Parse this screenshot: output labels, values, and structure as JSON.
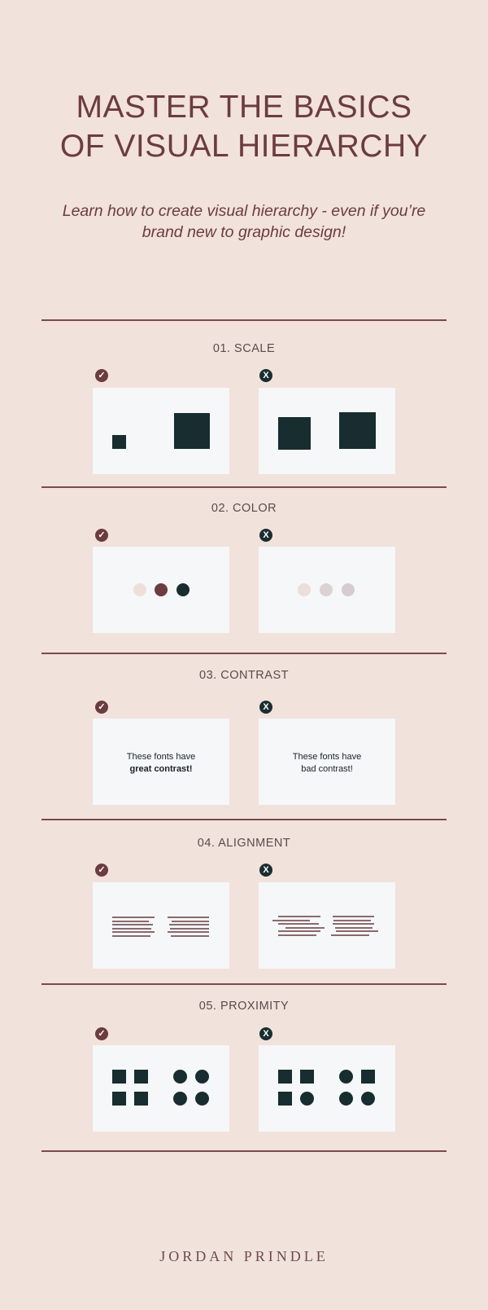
{
  "header": {
    "title_line1": "MASTER THE BASICS",
    "title_line2": "OF VISUAL HIERARCHY",
    "subtitle_line1": "Learn how to create visual hierarchy - even if you’re",
    "subtitle_line2": "brand new to graphic design!"
  },
  "badges": {
    "good_icon": "✓",
    "bad_icon": "X"
  },
  "colors": {
    "background": "#f2e2dc",
    "accent_maroon": "#6b3c40",
    "dark_teal": "#172d2f",
    "panel": "#f5f7f9",
    "good_dots": [
      "#eee0d8",
      "#6b3c40",
      "#172d2f"
    ],
    "bad_dots": [
      "#ecdeda",
      "#dcd2d2",
      "#d6cccd"
    ]
  },
  "sections": [
    {
      "title": "01. SCALE"
    },
    {
      "title": "02. COLOR"
    },
    {
      "title": "03. CONTRAST",
      "good_text_line1": "These fonts have",
      "good_text_line2": "great contrast!",
      "bad_text_line1": "These fonts have",
      "bad_text_line2": "bad contrast!"
    },
    {
      "title": "04. ALIGNMENT"
    },
    {
      "title": "05. PROXIMITY",
      "good_shapes": [
        "square",
        "square",
        "square",
        "square",
        "circle",
        "circle",
        "circle",
        "circle"
      ],
      "bad_shapes": [
        "square",
        "square",
        "square",
        "circle",
        "circle",
        "square",
        "circle",
        "circle"
      ]
    }
  ],
  "footer": {
    "brand": "JORDAN PRINDLE"
  }
}
